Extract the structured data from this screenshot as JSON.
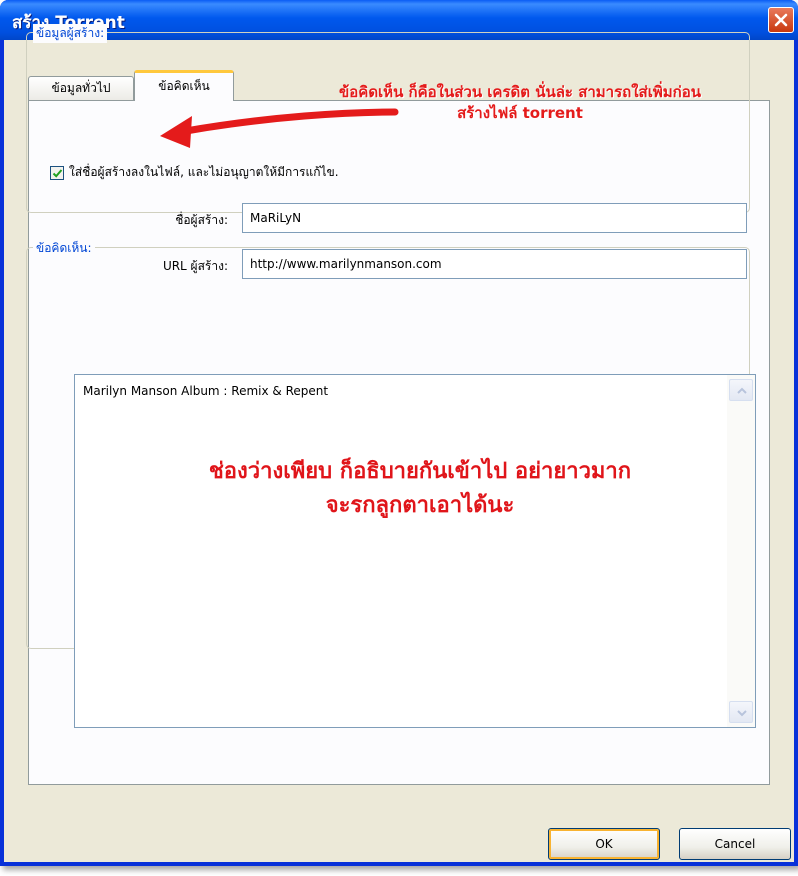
{
  "window": {
    "title": "สร้าง Torrent",
    "close_icon": "close-icon"
  },
  "tabs": [
    {
      "label": "ข้อมูลทั่วไป",
      "selected": false
    },
    {
      "label": "ข้อคิดเห็น",
      "selected": true
    }
  ],
  "creator_group": {
    "title": "ข้อมูลผู้สร้าง:",
    "checkbox_label": "ใส่ชื่อผู้สร้างลงในไฟล์, และไม่อนุญาตให้มีการแก้ไข.",
    "checkbox_checked": true,
    "name_label": "ชื่อผู้สร้าง:",
    "name_value": "MaRiLyN",
    "url_label": "URL ผู้สร้าง:",
    "url_value": "http://www.marilynmanson.com"
  },
  "comments_group": {
    "title": "ข้อคิดเห็น:",
    "text": "Marilyn Manson Album : Remix & Repent"
  },
  "buttons": {
    "ok": "OK",
    "cancel": "Cancel"
  },
  "annotations": {
    "top_line1": "ข้อคิดเห็น ก็คือในส่วน เครดิต นั่นล่ะ สามารถใส่เพิ่มก่อน",
    "top_line2": "สร้างไฟล์ torrent",
    "middle_line1": "ช่องว่างเพียบ ก็อธิบายกันเข้าไป อย่ายาวมาก",
    "middle_line2": "จะรกลูกตาเอาได้นะ",
    "color": "#E41B1B"
  },
  "colors": {
    "titlebar": "#0058EE",
    "dialog_bg": "#ECE9D8",
    "group_title": "#0046D5"
  }
}
